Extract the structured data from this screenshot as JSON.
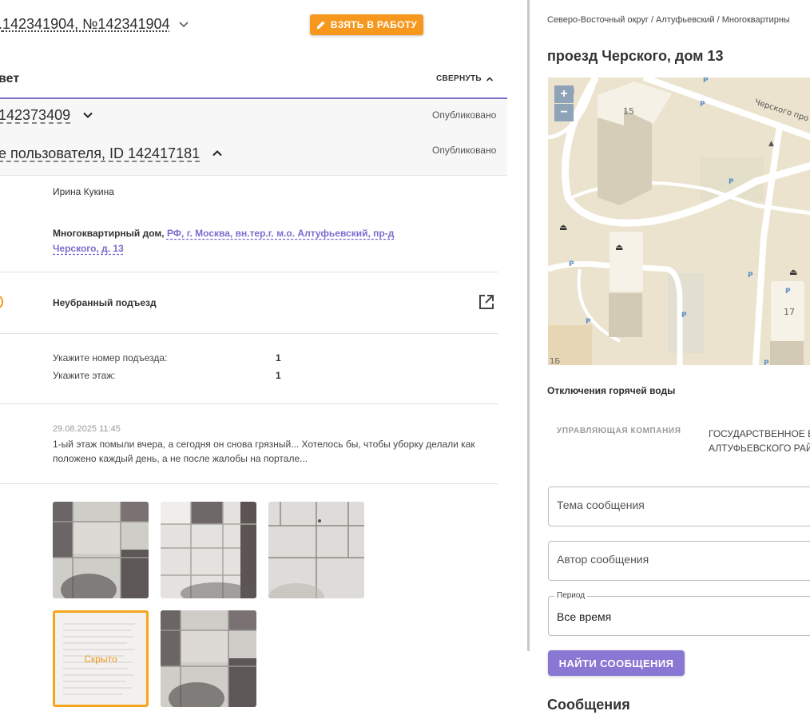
{
  "header": {
    "ticket_ids": "142341904, №142341904",
    "take_button": "ВЗЯТЬ В РАБОТУ"
  },
  "answer": {
    "title": "вет",
    "collapse": "СВЕРНУТЬ"
  },
  "rows": [
    {
      "id": "142373409",
      "status": "Опубликовано"
    },
    {
      "id": "е пользователя, ID 142417181",
      "status": "Опубликовано"
    }
  ],
  "details": {
    "author": "Ирина Кукина",
    "address_type": "Многоквартирный дом,",
    "address_link": "РФ, г. Москва, вн.тер.г. м.о. Алтуфьевский, пр-д Черского, д. 13",
    "problem": "Неубранный подъезд",
    "questions": [
      {
        "label": "Укажите номер подъезда:",
        "value": "1"
      },
      {
        "label": "Укажите этаж:",
        "value": "1"
      }
    ],
    "comment_date": "29.08.2025 11:45",
    "comment_text": "1-ый этаж помыли вчера, а сегодня он снова грязный... Хотелось бы, чтобы уборку делали как положено каждый день, а не после жалобы на портале...",
    "hidden_label": "Скрыто"
  },
  "right": {
    "breadcrumbs": "Северо-Восточный округ / Алтуфьевский / Многоквартирны",
    "address_title": "проезд Черского, дом 13",
    "map": {
      "zoom_in": "+",
      "zoom_out": "−",
      "street_label": "Черского про",
      "house_numbers": [
        "15",
        "17",
        "1Б"
      ]
    },
    "hot_water_title": "Отключения горячей воды",
    "mgmt_label": "УПРАВЛЯЮЩАЯ КОМПАНИЯ",
    "mgmt_value": "ГОСУДАРСТВЕННОЕ Б АЛТУФЬЕВСКОГО РАЙ",
    "subject_placeholder": "Тема сообщения",
    "author_placeholder": "Автор сообщения",
    "period_label": "Период",
    "period_value": "Все время",
    "find_button": "НАЙТИ СООБЩЕНИЯ",
    "messages_title": "Сообщения"
  },
  "icons": {
    "chevron": "chevron-down-icon",
    "pencil": "pencil-icon",
    "external": "external-link-icon"
  },
  "colors": {
    "accent_orange": "#f6981e",
    "accent_purple": "#7e6fc9",
    "button_purple": "#8877d3"
  }
}
